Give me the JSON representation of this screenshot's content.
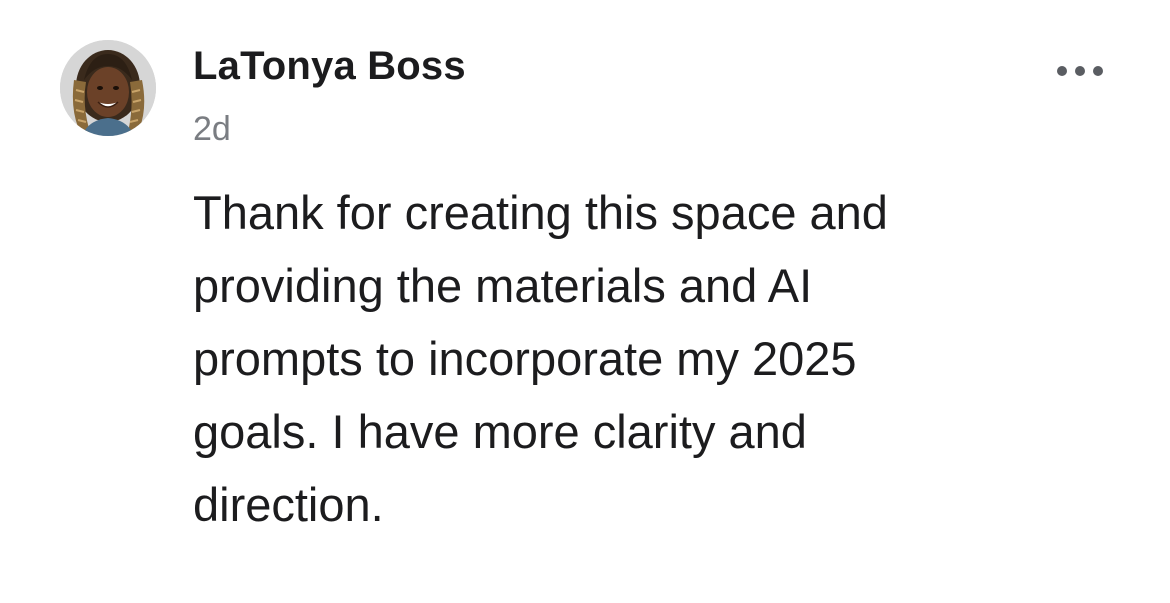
{
  "post": {
    "author": "LaTonya Boss",
    "timestamp": "2d",
    "body": "Thank for creating this space and\nproviding the materials and AI\nprompts to incorporate my 2025\ngoals.  I have more clarity and\ndirection.",
    "avatar_icon": "user-photo-avatar",
    "more_icon": "more-horizontal-icon"
  },
  "colors": {
    "name": "#1c1c1e",
    "timestamp": "#7a7d82",
    "body": "#1c1c1e",
    "more_icon": "#5a5d62",
    "background": "#ffffff"
  }
}
